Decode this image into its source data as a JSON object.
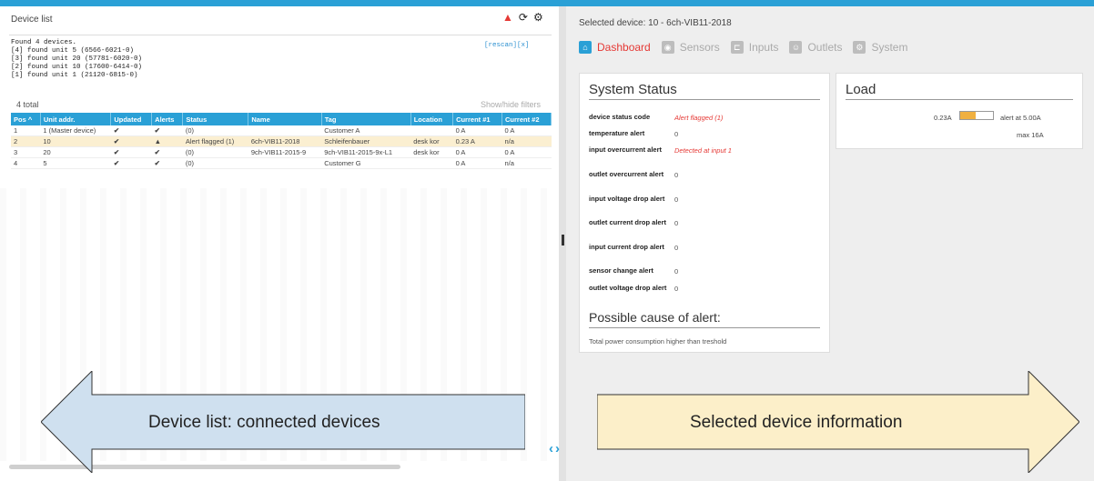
{
  "left": {
    "title": "Device list",
    "log_lines": [
      "Found 4 devices.",
      "[4] found unit 5 (6566-6021-0)",
      "[3] found unit 20 (57781-6020-0)",
      "[2] found unit 10 (17600-6414-0)",
      "[1] found unit 1 (21120-6815-0)"
    ],
    "rescan": "[rescan][x]",
    "total": "4 total",
    "filters": "Show/hide filters",
    "columns": [
      "Pos ^",
      "Unit addr.",
      "Updated",
      "Alerts",
      "Status",
      "Name",
      "Tag",
      "Location",
      "Current #1",
      "Current #2"
    ],
    "rows": [
      {
        "pos": "1",
        "unit": "1 (Master device)",
        "updated": "✔",
        "alerts": "✔",
        "status": "(0)",
        "name": "",
        "tag": "Customer A",
        "location": "",
        "c1": "0 A",
        "c2": "0 A"
      },
      {
        "pos": "2",
        "unit": "10",
        "updated": "✔",
        "alerts": "▲",
        "status": "Alert flagged (1)",
        "name": "6ch-VIB11-2018",
        "tag": "Schleifenbauer",
        "location": "desk kor",
        "c1": "0.23 A",
        "c2": "n/a"
      },
      {
        "pos": "3",
        "unit": "20",
        "updated": "✔",
        "alerts": "✔",
        "status": "(0)",
        "name": "9ch-VIB11-2015-9",
        "tag": "9ch-VIB11-2015-9x-L1",
        "location": "desk kor",
        "c1": "0 A",
        "c2": "0 A"
      },
      {
        "pos": "4",
        "unit": "5",
        "updated": "✔",
        "alerts": "✔",
        "status": "(0)",
        "name": "",
        "tag": "Customer G",
        "location": "",
        "c1": "0 A",
        "c2": "n/a"
      }
    ]
  },
  "right": {
    "title": "Selected device: 10 - 6ch-VIB11-2018",
    "tabs": [
      "Dashboard",
      "Sensors",
      "Inputs",
      "Outlets",
      "System"
    ],
    "status_card": {
      "heading": "System Status",
      "items": [
        {
          "k": "device status code",
          "v": "Alert flagged (1)"
        },
        {
          "k": "temperature alert",
          "v": "0"
        },
        {
          "k": "input overcurrent alert",
          "v": "Detected at input 1"
        },
        {
          "k": "outlet overcurrent alert",
          "v": "0"
        },
        {
          "k": "input voltage drop alert",
          "v": "0"
        },
        {
          "k": "outlet current drop alert",
          "v": "0"
        },
        {
          "k": "input current drop alert",
          "v": "0"
        },
        {
          "k": "sensor change alert",
          "v": "0"
        },
        {
          "k": "outlet voltage drop alert",
          "v": "0"
        }
      ],
      "cause_heading": "Possible cause of alert:",
      "cause": "Total power consumption higher than treshold"
    },
    "load_card": {
      "heading": "Load",
      "amps": "0.23A",
      "alert_at": "alert at  5.00A",
      "max": "max   16A",
      "load_fraction": 0.46
    }
  },
  "annotations": {
    "left_arrow": "Device list: connected devices",
    "right_arrow": "Selected device information"
  },
  "colors": {
    "accent": "#2aa0d6",
    "alert": "#e53935",
    "left_arrow_fill": "#cfe0ef",
    "right_arrow_fill": "#fcefc9"
  }
}
